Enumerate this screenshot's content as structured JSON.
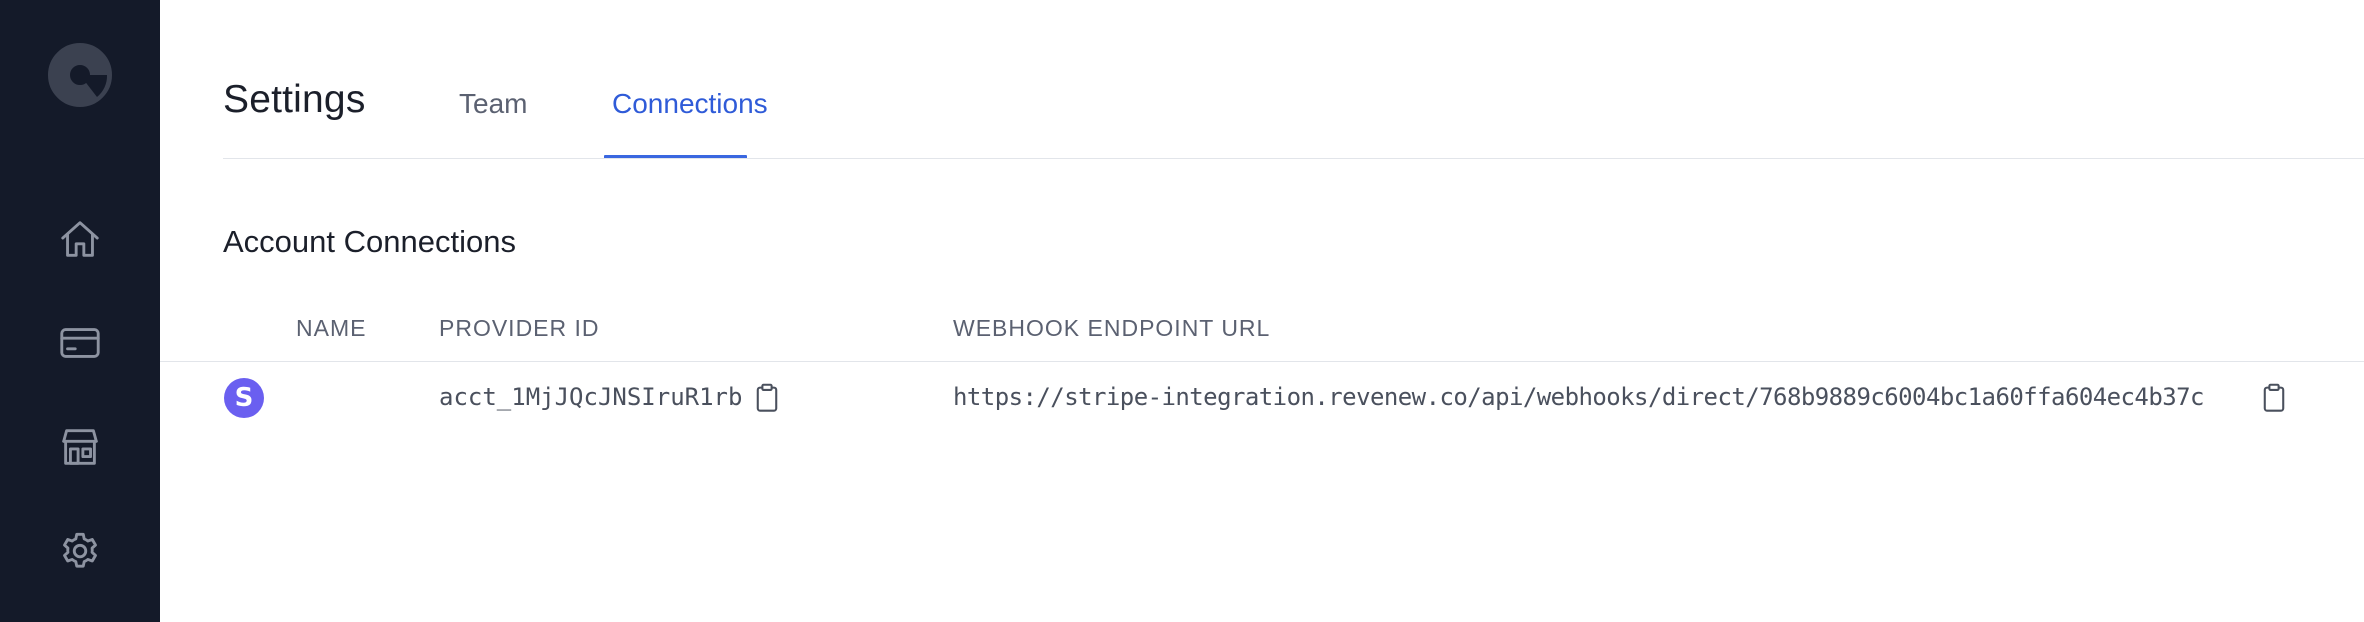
{
  "sidebar": {
    "logo_icon": "app-logo-icon",
    "items": [
      {
        "icon": "home-icon"
      },
      {
        "icon": "credit-card-icon"
      },
      {
        "icon": "store-icon"
      },
      {
        "icon": "gear-icon"
      }
    ]
  },
  "header": {
    "title": "Settings",
    "tabs": [
      {
        "label": "Team",
        "active": false
      },
      {
        "label": "Connections",
        "active": true
      }
    ]
  },
  "connections": {
    "title": "Account Connections",
    "columns": [
      "NAME",
      "PROVIDER ID",
      "WEBHOOK ENDPOINT URL"
    ],
    "rows": [
      {
        "provider_icon": "stripe-icon",
        "provider_letter": "S",
        "name": "",
        "provider_id": "acct_1MjJQcJNSIruR1rb",
        "webhook_url": "https://stripe-integration.revenew.co/api/webhooks/direct/768b9889c6004bc1a60ffa604ec4b37c"
      }
    ]
  },
  "colors": {
    "sidebar_bg": "#141a29",
    "accent": "#3a67e0",
    "stripe": "#6a5ff0"
  }
}
